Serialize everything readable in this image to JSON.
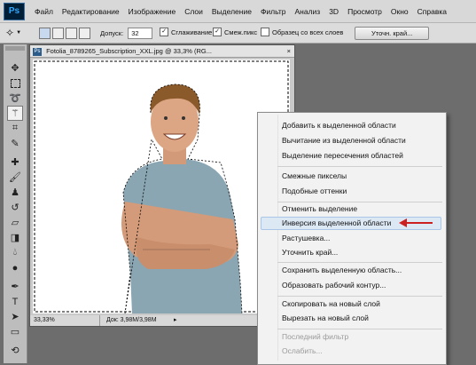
{
  "app": {
    "logo": "Ps"
  },
  "menubar": {
    "items": [
      "Файл",
      "Редактирование",
      "Изображение",
      "Слои",
      "Выделение",
      "Фильтр",
      "Анализ",
      "3D",
      "Просмотр",
      "Окно",
      "Справка"
    ]
  },
  "options": {
    "tolerance_label": "Допуск:",
    "tolerance_value": "32",
    "antialias_label": "Сглаживание",
    "antialias_checked": true,
    "contiguous_label": "Смеж.пикс",
    "contiguous_checked": true,
    "sample_all_label": "Образец со всех слоев",
    "sample_all_checked": false,
    "refine_edge_button": "Уточн. край..."
  },
  "document": {
    "title": "Fotolia_8789265_Subscription_XXL.jpg @ 33,3% (RG...",
    "zoom": "33,33%",
    "doc_size": "Док: 3,98M/3,98M"
  },
  "context_menu": {
    "items": [
      "Добавить к выделенной области",
      "Вычитание из выделенной области",
      "Выделение пересечения областей",
      "Смежные пикселы",
      "Подобные оттенки",
      "Отменить выделение",
      "Инверсия выделенной области",
      "Растушевка...",
      "Уточнить край...",
      "Сохранить выделенную область...",
      "Образовать рабочий контур...",
      "Скопировать на новый слой",
      "Вырезать на новый слой",
      "Последний фильтр",
      "Ослабить..."
    ],
    "highlighted_item": "Инверсия выделенной области",
    "disabled_items": [
      "Последний фильтр",
      "Ослабить..."
    ]
  },
  "colors": {
    "accent_arrow": "#cc1f1f",
    "menu_highlight": "#dde8f5",
    "workspace": "#6d6d6d"
  },
  "tools": [
    "move-tool-icon",
    "marquee-tool-icon",
    "lasso-tool-icon",
    "magic-wand-tool-icon",
    "crop-tool-icon",
    "eyedropper-tool-icon",
    "healing-brush-tool-icon",
    "brush-tool-icon",
    "clone-stamp-tool-icon",
    "history-brush-tool-icon",
    "eraser-tool-icon",
    "gradient-tool-icon",
    "blur-tool-icon",
    "dodge-tool-icon",
    "pen-tool-icon",
    "type-tool-icon",
    "path-selection-tool-icon",
    "shape-tool-icon",
    "3d-rotate-tool-icon",
    "hand-tool-icon"
  ]
}
